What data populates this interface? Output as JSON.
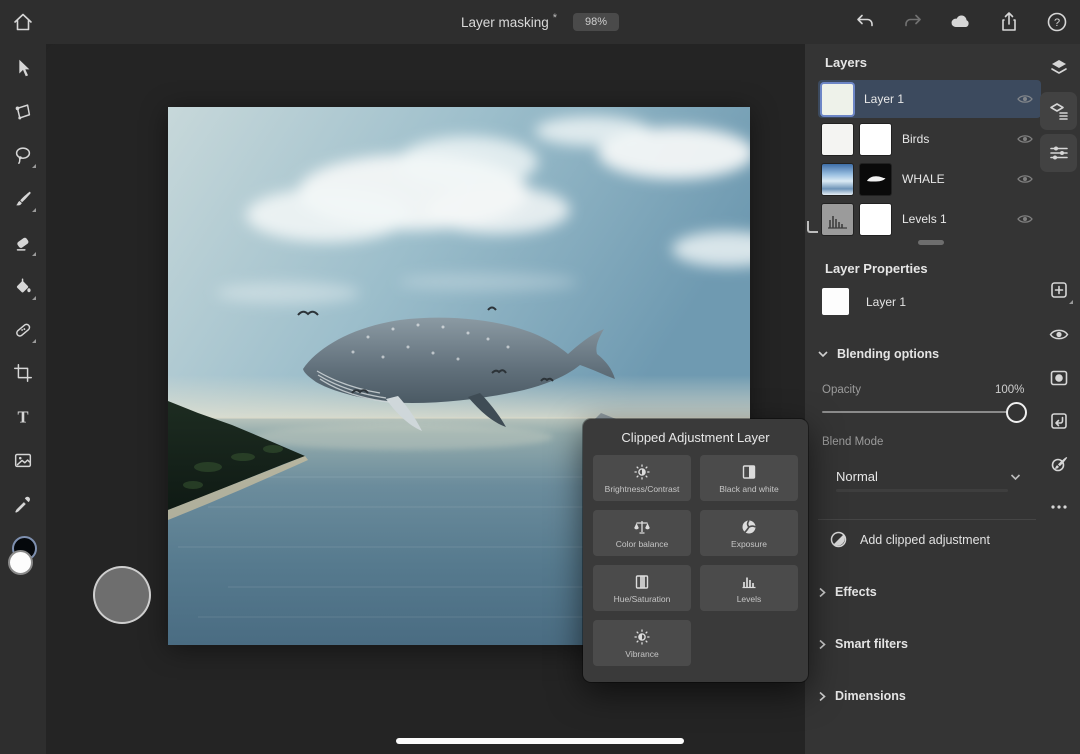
{
  "topbar": {
    "title": "Layer masking",
    "modified_indicator": "*",
    "zoom_badge": "98%"
  },
  "icons": {
    "type_tool_glyph": "T",
    "help_glyph": "?",
    "topbar_right": [
      "undo",
      "redo",
      "cloud-sync",
      "share",
      "help"
    ],
    "toolbar": [
      "move",
      "transform",
      "lasso",
      "brush",
      "eraser",
      "fill",
      "healing",
      "crop",
      "type",
      "place-image",
      "eyedropper",
      "color-swatches"
    ],
    "right_strip": [
      "layers",
      "layer-properties",
      "adjustments",
      "add-layer",
      "visibility",
      "layer-mask",
      "clip-layer",
      "paint",
      "more-options"
    ]
  },
  "layers_panel": {
    "title": "Layers",
    "items": [
      {
        "name": "Layer 1"
      },
      {
        "name": "Birds"
      },
      {
        "name": "WHALE"
      },
      {
        "name": "Levels 1"
      }
    ]
  },
  "layer_properties": {
    "title": "Layer Properties",
    "layer_name": "Layer 1",
    "blending_header": "Blending options",
    "opacity_label": "Opacity",
    "opacity_value": "100%",
    "blend_mode_label": "Blend Mode",
    "blend_mode_value": "Normal",
    "add_clipped_label": "Add clipped adjustment",
    "sections": [
      {
        "label": "Effects"
      },
      {
        "label": "Smart filters"
      },
      {
        "label": "Dimensions"
      }
    ]
  },
  "popup": {
    "title": "Clipped Adjustment Layer",
    "buttons": [
      {
        "label": "Brightness/Contrast"
      },
      {
        "label": "Black and white"
      },
      {
        "label": "Color balance"
      },
      {
        "label": "Exposure"
      },
      {
        "label": "Hue/Saturation"
      },
      {
        "label": "Levels"
      },
      {
        "label": "Vibrance"
      }
    ]
  },
  "colors": {
    "selection_blue": "#3c4a5e",
    "panel_bg": "#343434",
    "workspace_bg": "#242424",
    "chrome_bg": "#2e2e2e",
    "popup_button_bg": "#4b4b4b",
    "badge_bg": "#4a4a4a"
  }
}
